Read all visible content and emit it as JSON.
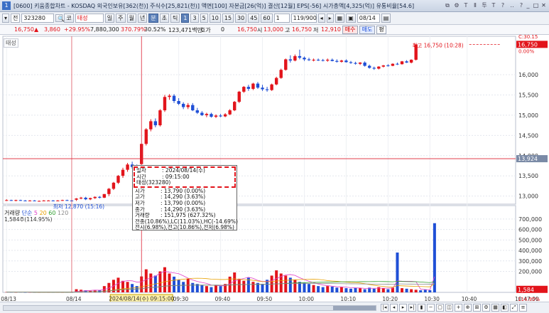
{
  "titlebar": {
    "number": "1",
    "title": "[0600] 키움종합차트 - KOSDAQ 외국인보유[362(천)] 주식수[25,821(천)] 액면[100] 자본금[26(억)] 결산[12월] EPS[-56] 시가총액[4,325(억)] 유통비율[54.6]",
    "icons": [
      "⧉",
      "⚙",
      "T",
      "Ⅱ",
      "투",
      "T",
      "?",
      "‥",
      "?"
    ],
    "window_buttons": [
      "_",
      "□",
      "✕"
    ]
  },
  "toolbar": {
    "dropdown": "▾",
    "mode": "전",
    "code": "323280",
    "search_icon": "🔍",
    "name_prefix": "코",
    "name": "태성",
    "periods": [
      "일",
      "주",
      "월",
      "년",
      "분",
      "초",
      "틱"
    ],
    "selected_period": "분",
    "intervals": [
      "1",
      "3",
      "5",
      "10",
      "15",
      "30",
      "45",
      "60"
    ],
    "interval_value": "1",
    "count": "119/900",
    "date": "08/14"
  },
  "infobar": {
    "price": "16,750",
    "arrow": "▲",
    "change": "3,860",
    "change_pct": "+29.95%",
    "volume": "7,880,300",
    "vol_ratio": "370.79%",
    "turnover": "30.52%",
    "amount": "123,471백만",
    "quote_label": "호가",
    "quote_val": "0",
    "cur": "16,750",
    "open_label": "시",
    "open": "13,000",
    "high_label": "고",
    "high": "16,750",
    "low_label": "저",
    "low": "12,910",
    "buy": "매수",
    "sell": "매도",
    "pyeong": "평"
  },
  "chart": {
    "tab_label": "태성",
    "high_annotation": "최고 16,750 (10:28)",
    "low_annotation": "최저 12,870 (15:16)",
    "current_price_tag": "16,750",
    "current_pct_tag": "0.00%",
    "top_tag": "C:30.15",
    "crosshair_price_tag": "13,924",
    "price_ticks": [
      "16,000",
      "15,500",
      "15,000",
      "14,500",
      "14,000",
      "13,500",
      "13,000"
    ],
    "time_ticks": [
      "08/13",
      "08/14",
      "09:30",
      "09:40",
      "09:50",
      "10:00",
      "10:10",
      "10:20",
      "10:30",
      "10:40",
      "10:47:00"
    ],
    "crosshair_time": "2024/08/14(수) 09:15:00",
    "volume_legend": {
      "name": "거래량",
      "ma_label": "단순",
      "periods": [
        "5",
        "20",
        "60",
        "120"
      ],
      "sub": "1,584주(114.95%)"
    },
    "volume_ticks": [
      "700,000",
      "600,000",
      "500,000",
      "400,000",
      "300,000",
      "200,000"
    ],
    "volume_current_tag": "1,584",
    "volume_pct_tag": "114.95%",
    "colors": {
      "up": "#e2141b",
      "down": "#1f4fd6",
      "ma5": "#e040c8",
      "ma20": "#e8a000",
      "ma60": "#2e9e2e",
      "ma120": "#888888"
    }
  },
  "tooltip": {
    "date_label": "일자",
    "date": "2024/08/14(수)",
    "time_label": "시간",
    "time": "09:15:00",
    "name": "태성(323280)",
    "rows": [
      {
        "k": "시가",
        "v": ": 13,790 (0.00%)"
      },
      {
        "k": "고가",
        "v": ": 14,290 (3.63%)"
      },
      {
        "k": "저가",
        "v": ": 13,790 (0.00%)"
      },
      {
        "k": "종가",
        "v": ": 14,290 (3.63%)"
      },
      {
        "k": "거래량",
        "v": ": 151,975 (627.32%)"
      }
    ],
    "line1": "전종(10.86%),LC(11.03%),HC(-14.69%)",
    "line2": "전시(6.98%),전고(10.86%),전저(6.98%)"
  },
  "chart_data": {
    "type": "candlestick",
    "y_range": [
      12800,
      16950
    ],
    "candles": [
      {
        "o": 12900,
        "h": 12920,
        "l": 12880,
        "c": 12900
      },
      {
        "o": 12900,
        "h": 12910,
        "l": 12880,
        "c": 12890
      },
      {
        "o": 12890,
        "h": 12910,
        "l": 12870,
        "c": 12900
      },
      {
        "o": 12900,
        "h": 12910,
        "l": 12880,
        "c": 12890
      },
      {
        "o": 12890,
        "h": 12900,
        "l": 12870,
        "c": 12880
      },
      {
        "o": 12880,
        "h": 12900,
        "l": 12870,
        "c": 12890
      },
      {
        "o": 12890,
        "h": 12900,
        "l": 12870,
        "c": 12880
      },
      {
        "o": 12880,
        "h": 12890,
        "l": 12870,
        "c": 12880
      },
      {
        "o": 12880,
        "h": 12900,
        "l": 12870,
        "c": 12890
      },
      {
        "o": 12890,
        "h": 12900,
        "l": 12880,
        "c": 12890
      },
      {
        "o": 12890,
        "h": 12900,
        "l": 12870,
        "c": 12880
      },
      {
        "o": 12880,
        "h": 12900,
        "l": 12870,
        "c": 12890
      },
      {
        "o": 12890,
        "h": 12910,
        "l": 12880,
        "c": 12900
      },
      {
        "o": 12900,
        "h": 12910,
        "l": 12880,
        "c": 12890
      },
      {
        "o": 12890,
        "h": 12900,
        "l": 12870,
        "c": 12880
      },
      {
        "o": 12910,
        "h": 12950,
        "l": 12880,
        "c": 12940
      },
      {
        "o": 12940,
        "h": 12980,
        "l": 12920,
        "c": 12960
      },
      {
        "o": 12960,
        "h": 12980,
        "l": 12900,
        "c": 12920
      },
      {
        "o": 12920,
        "h": 12960,
        "l": 12900,
        "c": 12950
      },
      {
        "o": 12950,
        "h": 12990,
        "l": 12930,
        "c": 12980
      },
      {
        "o": 12980,
        "h": 13000,
        "l": 12940,
        "c": 12960
      },
      {
        "o": 12960,
        "h": 13050,
        "l": 12950,
        "c": 13050
      },
      {
        "o": 13050,
        "h": 13200,
        "l": 13000,
        "c": 13180
      },
      {
        "o": 13180,
        "h": 13350,
        "l": 13150,
        "c": 13330
      },
      {
        "o": 13330,
        "h": 13520,
        "l": 13300,
        "c": 13500
      },
      {
        "o": 13500,
        "h": 13700,
        "l": 13450,
        "c": 13650
      },
      {
        "o": 13650,
        "h": 13820,
        "l": 13600,
        "c": 13780
      },
      {
        "o": 13780,
        "h": 13850,
        "l": 13680,
        "c": 13720
      },
      {
        "o": 13720,
        "h": 13780,
        "l": 13600,
        "c": 13650
      },
      {
        "o": 13790,
        "h": 14290,
        "l": 13790,
        "c": 14290
      },
      {
        "o": 14290,
        "h": 14680,
        "l": 14250,
        "c": 14650
      },
      {
        "o": 14650,
        "h": 14900,
        "l": 14600,
        "c": 14850
      },
      {
        "o": 14850,
        "h": 14920,
        "l": 14700,
        "c": 14750
      },
      {
        "o": 14750,
        "h": 15150,
        "l": 14720,
        "c": 15120
      },
      {
        "o": 15120,
        "h": 15500,
        "l": 15080,
        "c": 15450
      },
      {
        "o": 15450,
        "h": 15520,
        "l": 15380,
        "c": 15480
      },
      {
        "o": 15480,
        "h": 15520,
        "l": 15300,
        "c": 15350
      },
      {
        "o": 15350,
        "h": 15420,
        "l": 15250,
        "c": 15280
      },
      {
        "o": 15280,
        "h": 15320,
        "l": 15150,
        "c": 15200
      },
      {
        "o": 15200,
        "h": 15300,
        "l": 15150,
        "c": 15250
      },
      {
        "o": 15250,
        "h": 15300,
        "l": 15100,
        "c": 15120
      },
      {
        "o": 15120,
        "h": 15180,
        "l": 15030,
        "c": 15060
      },
      {
        "o": 15060,
        "h": 15100,
        "l": 14980,
        "c": 15000
      },
      {
        "o": 15000,
        "h": 15060,
        "l": 14950,
        "c": 15030
      },
      {
        "o": 15030,
        "h": 15060,
        "l": 14940,
        "c": 14960
      },
      {
        "o": 14960,
        "h": 15020,
        "l": 14930,
        "c": 14990
      },
      {
        "o": 14990,
        "h": 15030,
        "l": 14950,
        "c": 14970
      },
      {
        "o": 14970,
        "h": 15050,
        "l": 14950,
        "c": 15020
      },
      {
        "o": 15020,
        "h": 15150,
        "l": 15000,
        "c": 15120
      },
      {
        "o": 15120,
        "h": 15350,
        "l": 15100,
        "c": 15330
      },
      {
        "o": 15330,
        "h": 15600,
        "l": 15300,
        "c": 15580
      },
      {
        "o": 15580,
        "h": 15720,
        "l": 15550,
        "c": 15700
      },
      {
        "o": 15700,
        "h": 15750,
        "l": 15600,
        "c": 15650
      },
      {
        "o": 15650,
        "h": 15800,
        "l": 15620,
        "c": 15780
      },
      {
        "o": 15780,
        "h": 15820,
        "l": 15650,
        "c": 15680
      },
      {
        "o": 15680,
        "h": 15750,
        "l": 15600,
        "c": 15640
      },
      {
        "o": 15640,
        "h": 15700,
        "l": 15580,
        "c": 15620
      },
      {
        "o": 15620,
        "h": 15780,
        "l": 15600,
        "c": 15760
      },
      {
        "o": 15760,
        "h": 15950,
        "l": 15740,
        "c": 15920
      },
      {
        "o": 15920,
        "h": 16150,
        "l": 15900,
        "c": 16120
      },
      {
        "o": 16120,
        "h": 16400,
        "l": 16100,
        "c": 16380
      },
      {
        "o": 16380,
        "h": 16480,
        "l": 16300,
        "c": 16350
      },
      {
        "o": 16350,
        "h": 16500,
        "l": 16330,
        "c": 16460
      },
      {
        "o": 16460,
        "h": 16620,
        "l": 16380,
        "c": 16420
      },
      {
        "o": 16420,
        "h": 16450,
        "l": 16340,
        "c": 16380
      },
      {
        "o": 16380,
        "h": 16420,
        "l": 16340,
        "c": 16360
      },
      {
        "o": 16360,
        "h": 16400,
        "l": 16330,
        "c": 16370
      },
      {
        "o": 16370,
        "h": 16400,
        "l": 16340,
        "c": 16360
      },
      {
        "o": 16360,
        "h": 16390,
        "l": 16330,
        "c": 16350
      },
      {
        "o": 16350,
        "h": 16400,
        "l": 16320,
        "c": 16370
      },
      {
        "o": 16370,
        "h": 16400,
        "l": 16330,
        "c": 16340
      },
      {
        "o": 16340,
        "h": 16380,
        "l": 16300,
        "c": 16320
      },
      {
        "o": 16320,
        "h": 16370,
        "l": 16300,
        "c": 16350
      },
      {
        "o": 16350,
        "h": 16380,
        "l": 16300,
        "c": 16310
      },
      {
        "o": 16310,
        "h": 16340,
        "l": 16270,
        "c": 16290
      },
      {
        "o": 16290,
        "h": 16320,
        "l": 16250,
        "c": 16270
      },
      {
        "o": 16270,
        "h": 16310,
        "l": 16240,
        "c": 16300
      },
      {
        "o": 16300,
        "h": 16330,
        "l": 16200,
        "c": 16220
      },
      {
        "o": 16220,
        "h": 16250,
        "l": 16150,
        "c": 16170
      },
      {
        "o": 16170,
        "h": 16200,
        "l": 16120,
        "c": 16150
      },
      {
        "o": 16150,
        "h": 16210,
        "l": 16130,
        "c": 16200
      },
      {
        "o": 16200,
        "h": 16240,
        "l": 16180,
        "c": 16230
      },
      {
        "o": 16230,
        "h": 16260,
        "l": 16200,
        "c": 16220
      },
      {
        "o": 16220,
        "h": 16280,
        "l": 16210,
        "c": 16270
      },
      {
        "o": 16270,
        "h": 16300,
        "l": 16240,
        "c": 16260
      },
      {
        "o": 16260,
        "h": 16340,
        "l": 16250,
        "c": 16330
      },
      {
        "o": 16330,
        "h": 16360,
        "l": 16290,
        "c": 16300
      },
      {
        "o": 16300,
        "h": 16380,
        "l": 16280,
        "c": 16370
      },
      {
        "o": 16370,
        "h": 16750,
        "l": 16350,
        "c": 16750
      }
    ],
    "volumes": [
      3000,
      2500,
      2000,
      2800,
      1500,
      2200,
      1800,
      1600,
      2500,
      2000,
      1800,
      2400,
      1500,
      1900,
      1600,
      30000,
      25000,
      20000,
      15000,
      18000,
      22000,
      60000,
      90000,
      120000,
      140000,
      110000,
      100000,
      80000,
      60000,
      151975,
      220000,
      180000,
      160000,
      200000,
      240000,
      180000,
      150000,
      120000,
      100000,
      130000,
      90000,
      80000,
      70000,
      60000,
      50000,
      70000,
      60000,
      80000,
      150000,
      190000,
      130000,
      110000,
      140000,
      100000,
      90000,
      80000,
      120000,
      160000,
      210000,
      180000,
      160000,
      140000,
      120000,
      100000,
      90000,
      80000,
      70000,
      60000,
      50000,
      60000,
      55000,
      45000,
      50000,
      40000,
      35000,
      45000,
      40000,
      30000,
      45000,
      35000,
      50000,
      40000,
      30000,
      45000,
      380000,
      40000,
      35000,
      30000,
      25000,
      20000,
      25000,
      20000,
      660000
    ],
    "volume_range": [
      0,
      760000
    ]
  }
}
